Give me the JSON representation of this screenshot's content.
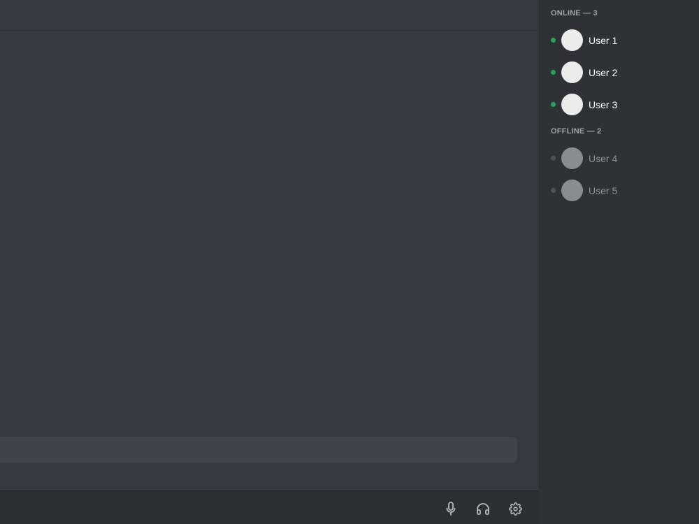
{
  "members": {
    "online_header": "ONLINE — 3",
    "offline_header": "OFFLINE — 2",
    "online": [
      {
        "name": "User 1"
      },
      {
        "name": "User 2"
      },
      {
        "name": "User 3"
      }
    ],
    "offline": [
      {
        "name": "User 4"
      },
      {
        "name": "User 5"
      }
    ]
  },
  "composer": {
    "value": "",
    "placeholder": ""
  },
  "controls": {
    "mic_icon": "microphone-icon",
    "headphones_icon": "headphones-icon",
    "settings_icon": "gear-icon"
  },
  "colors": {
    "online_status": "#23a55a",
    "offline_status": "#4f525a",
    "online_avatar": "#ececec",
    "offline_avatar": "#8b8c91",
    "online_name": "#ffffff",
    "offline_name": "#8e9197"
  }
}
